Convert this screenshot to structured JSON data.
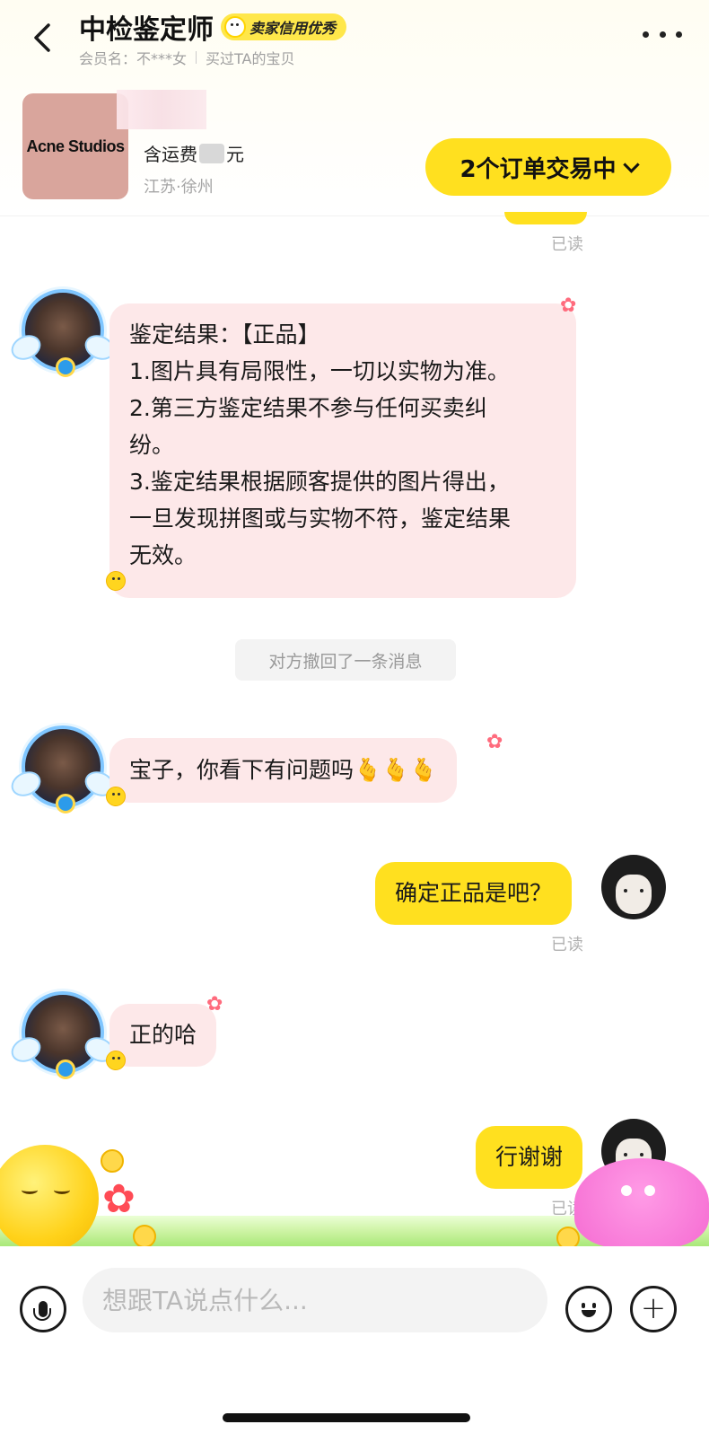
{
  "header": {
    "title": "中检鉴定师",
    "credit_badge": "卖家信用优秀",
    "member_label": "会员名：不***女",
    "bought_label": "买过TA的宝贝"
  },
  "product": {
    "thumb_text": "Acne Studios",
    "price_prefix": "含运费",
    "price_suffix": "元",
    "location": "江苏·徐州",
    "orders_button": "2个订单交易中"
  },
  "messages": [
    {
      "side": "left",
      "lines": [
        "鉴定结果：【正品】",
        "1.图片具有局限性，一切以实物为准。",
        "2.第三方鉴定结果不参与任何买卖纠",
        "纷。",
        "3.鉴定结果根据顾客提供的图片得出，",
        "一旦发现拼图或与实物不符，鉴定结果",
        "无效。"
      ]
    },
    {
      "side": "left",
      "text": "宝子，你看下有问题吗🫰🫰🫰"
    },
    {
      "side": "right",
      "text": "确定正品是吧？"
    },
    {
      "side": "left",
      "text": "正的哈"
    },
    {
      "side": "right",
      "text": "行谢谢"
    }
  ],
  "read_label": "已读",
  "system_message": "对方撤回了一条消息",
  "input": {
    "placeholder": "想跟TA说点什么..."
  },
  "icons": [
    "back-icon",
    "more-icon",
    "voice-icon",
    "emoji-icon",
    "plus-icon"
  ]
}
